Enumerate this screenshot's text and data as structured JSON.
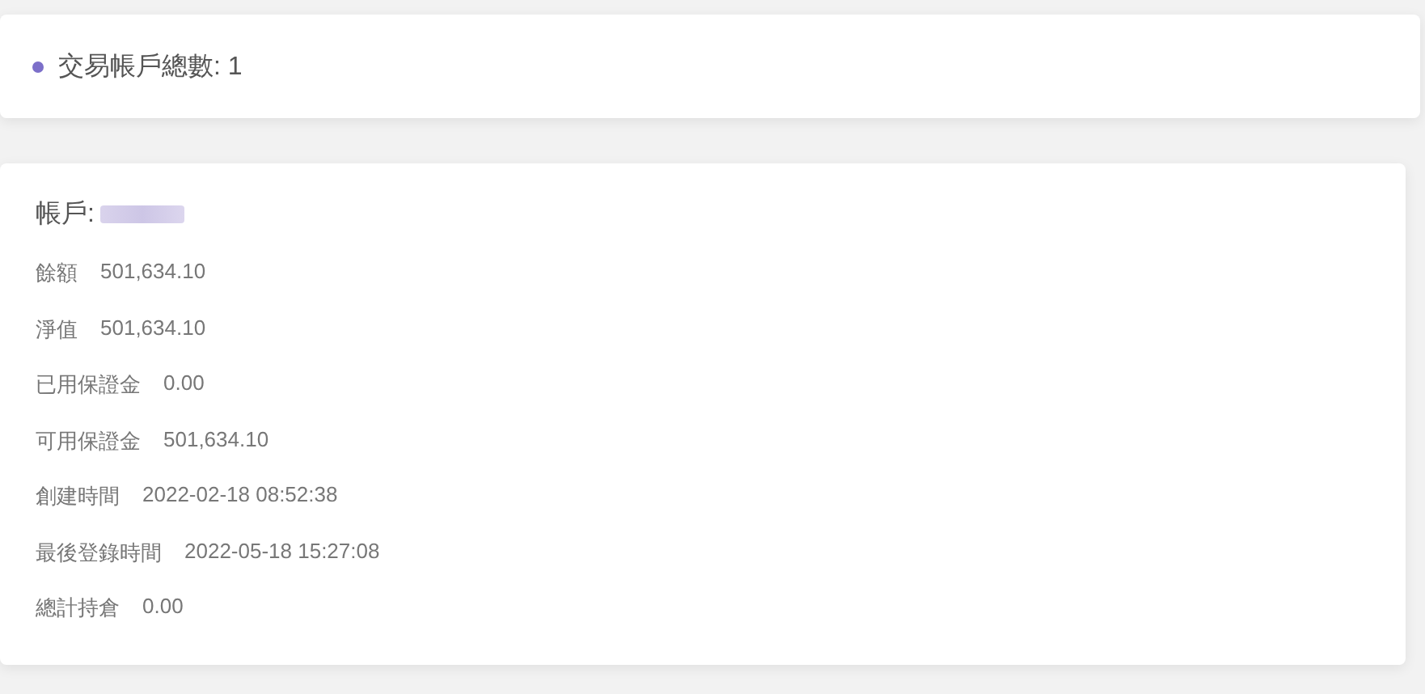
{
  "summary": {
    "label": "交易帳戶總數: 1",
    "color": "#7c6fc9"
  },
  "account": {
    "title": "帳戶:",
    "number_redacted": true,
    "fields": [
      {
        "label": "餘額",
        "value": "501,634.10"
      },
      {
        "label": "淨值",
        "value": "501,634.10"
      },
      {
        "label": "已用保證金",
        "value": "0.00"
      },
      {
        "label": "可用保證金",
        "value": "501,634.10"
      },
      {
        "label": "創建時間",
        "value": "2022-02-18 08:52:38"
      },
      {
        "label": "最後登錄時間",
        "value": "2022-05-18 15:27:08"
      },
      {
        "label": "總計持倉",
        "value": "0.00"
      }
    ]
  }
}
